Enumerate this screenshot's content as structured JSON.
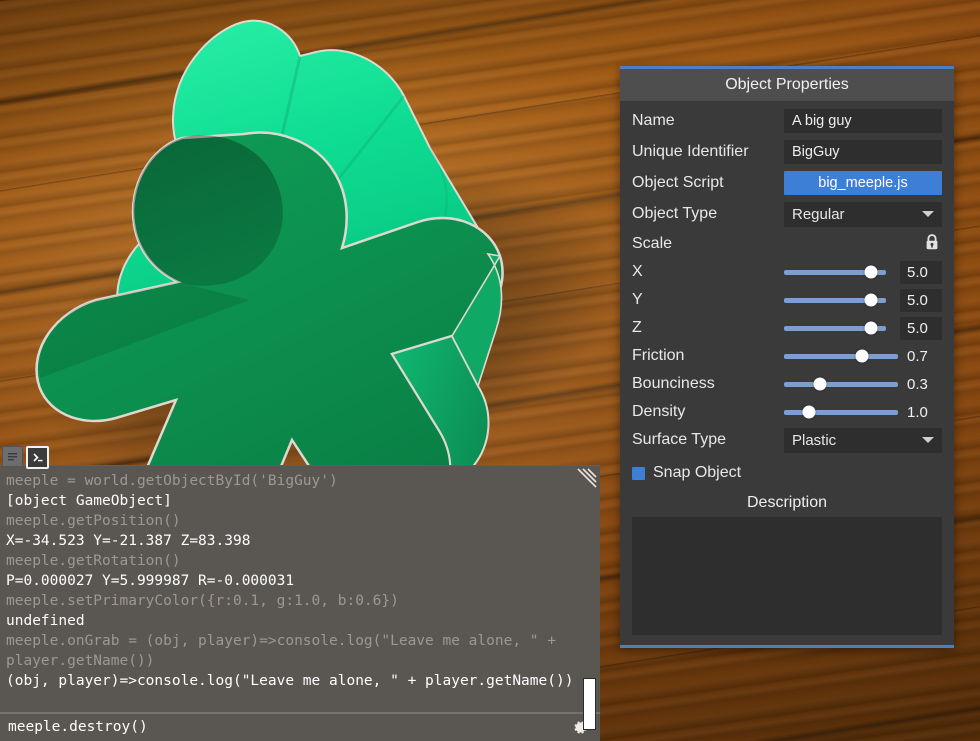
{
  "viewport": {
    "scene_name": "meeple-3d-scene",
    "object_colors": {
      "highlight": "#00e08c",
      "mid": "#10a85f",
      "shadow": "#0b7d45",
      "outline": "#d8d6cf"
    },
    "table_color": "#9c5714"
  },
  "console": {
    "tabs": [
      {
        "name": "log-tab",
        "icon": "log-lines-icon",
        "active": false
      },
      {
        "name": "script-tab",
        "icon": "terminal-prompt-icon",
        "active": true
      }
    ],
    "lines": [
      {
        "type": "in",
        "text": "meeple = world.getObjectById('BigGuy')"
      },
      {
        "type": "out",
        "text": "[object GameObject]"
      },
      {
        "type": "in",
        "text": "meeple.getPosition()"
      },
      {
        "type": "out",
        "text": "X=-34.523 Y=-21.387 Z=83.398"
      },
      {
        "type": "in",
        "text": "meeple.getRotation()"
      },
      {
        "type": "out",
        "text": "P=0.000027 Y=5.999987 R=-0.000031"
      },
      {
        "type": "in",
        "text": "meeple.setPrimaryColor({r:0.1, g:1.0, b:0.6})"
      },
      {
        "type": "out",
        "text": "undefined"
      },
      {
        "type": "in",
        "text": "meeple.onGrab = (obj, player)=>console.log(\"Leave me alone, \" + player.getName())"
      },
      {
        "type": "out",
        "text": "(obj, player)=>console.log(\"Leave me alone, \" + player.getName())"
      }
    ],
    "input_value": "meeple.destroy()",
    "input_placeholder": "",
    "gear_icon": "gear-icon",
    "resize_grip": "resize-grip-icon"
  },
  "panel": {
    "title": "Object Properties",
    "accent_color": "#4a7fc1",
    "name": {
      "label": "Name",
      "value": "A big guy"
    },
    "uid": {
      "label": "Unique Identifier",
      "value": "BigGuy"
    },
    "script": {
      "label": "Object Script",
      "value": "big_meeple.js"
    },
    "object_type": {
      "label": "Object Type",
      "value": "Regular"
    },
    "scale": {
      "label": "Scale",
      "lock_icon": "lock-closed-icon",
      "axes": [
        {
          "label": "X",
          "value": "5.0",
          "percent": 85
        },
        {
          "label": "Y",
          "value": "5.0",
          "percent": 85
        },
        {
          "label": "Z",
          "value": "5.0",
          "percent": 85
        }
      ]
    },
    "physics": [
      {
        "label": "Friction",
        "value": "0.7",
        "percent": 68
      },
      {
        "label": "Bounciness",
        "value": "0.3",
        "percent": 32
      },
      {
        "label": "Density",
        "value": "1.0",
        "percent": 22
      }
    ],
    "surface_type": {
      "label": "Surface Type",
      "value": "Plastic"
    },
    "snap_object": {
      "label": "Snap Object",
      "checked": true
    },
    "description": {
      "label": "Description",
      "value": ""
    }
  }
}
